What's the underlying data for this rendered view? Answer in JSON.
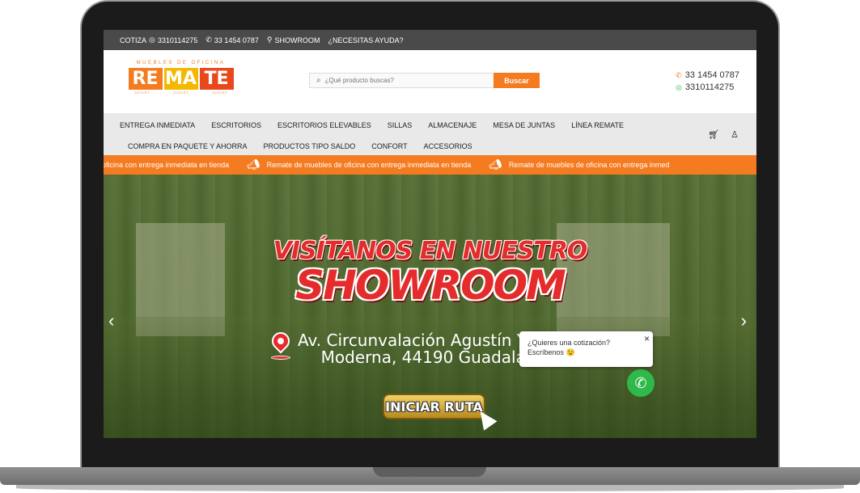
{
  "topbar": {
    "cotiza_label": "COTIZA",
    "cotiza_phone": "3310114275",
    "phone": "33 1454 0787",
    "showroom": "SHOWROOM",
    "ayuda": "¿NECESITAS AYUDA?"
  },
  "logo": {
    "top_text": "MUEBLES DE OFICINA",
    "blocks": [
      "RE",
      "MA",
      "TE"
    ],
    "sub": [
      "OUTLET",
      "OUTLET",
      "OUTLET"
    ]
  },
  "search": {
    "placeholder": "¿Qué producto buscas?",
    "button": "Buscar"
  },
  "contact": {
    "phone": "33 1454 0787",
    "whatsapp": "3310114275"
  },
  "nav": {
    "row1": [
      "ENTREGA INMEDIATA",
      "ESCRITORIOS",
      "ESCRITORIOS ELEVABLES",
      "SILLAS",
      "ALMACENAJE",
      "MESA DE JUNTAS",
      "LÍNEA REMATE"
    ],
    "row2": [
      "COMPRA EN PAQUETE Y AHORRA",
      "PRODUCTOS TIPO SALDO",
      "CONFORT",
      "ACCESORIOS"
    ]
  },
  "ticker": {
    "text_partial": "oficina con entrega inmediata en tienda",
    "text": "Remate de muebles de oficina con entrega inmediata en tienda",
    "text_end": "Remate de muebles de oficina con entrega inmed"
  },
  "hero": {
    "title1": "VISÍTANOS EN NUESTRO",
    "title2": "SHOWROOM",
    "address_line1": "Av. Circunvalación Agustín Yáñez 1293,",
    "address_line2": "Moderna, 44190 Guadalajara, Jal.",
    "button": "INICIAR RUTA"
  },
  "chat": {
    "line1": "¿Quieres una cotización?",
    "line2": "Escríbenos 😉",
    "close": "×"
  },
  "colors": {
    "accent": "#f47b20",
    "topbar": "#4a4a4a",
    "nav_bg": "#e9e9e9",
    "whatsapp": "#2fb94a",
    "title_red": "#e52b2b"
  }
}
